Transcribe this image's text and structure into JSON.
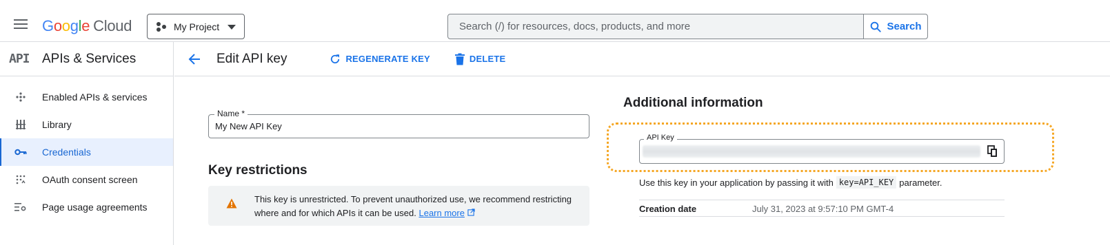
{
  "topbar": {
    "logo_g1": "G",
    "logo_g2": "o",
    "logo_g3": "o",
    "logo_g4": "g",
    "logo_g5": "l",
    "logo_g6": "e",
    "logo_cloud": "Cloud",
    "project_label": "My Project",
    "search_placeholder": "Search (/) for resources, docs, products, and more",
    "search_button": "Search"
  },
  "sidebar": {
    "logo_text": "API",
    "title": "APIs & Services",
    "items": [
      {
        "label": "Enabled APIs & services",
        "icon": "api-diamond-icon"
      },
      {
        "label": "Library",
        "icon": "library-icon"
      },
      {
        "label": "Credentials",
        "icon": "key-icon",
        "active": true
      },
      {
        "label": "OAuth consent screen",
        "icon": "consent-icon"
      },
      {
        "label": "Page usage agreements",
        "icon": "settings-list-icon"
      }
    ]
  },
  "header": {
    "title": "Edit API key",
    "regenerate": "REGENERATE KEY",
    "delete": "DELETE"
  },
  "form": {
    "name_label": "Name *",
    "name_value": "My New API Key",
    "restrictions_title": "Key restrictions",
    "warning_text": "This key is unrestricted. To prevent unauthorized use, we recommend restricting where and for which APIs it can be used.",
    "learn_more": "Learn more"
  },
  "additional": {
    "title": "Additional information",
    "api_key_label": "API Key",
    "help_prefix": "Use this key in your application by passing it with",
    "help_code": "key=API_KEY",
    "help_suffix": "parameter.",
    "creation_label": "Creation date",
    "creation_value": "July 31, 2023 at 9:57:10 PM GMT-4"
  },
  "colors": {
    "accent": "#1a73e8",
    "highlight": "#f5a623",
    "warning": "#e37400"
  }
}
